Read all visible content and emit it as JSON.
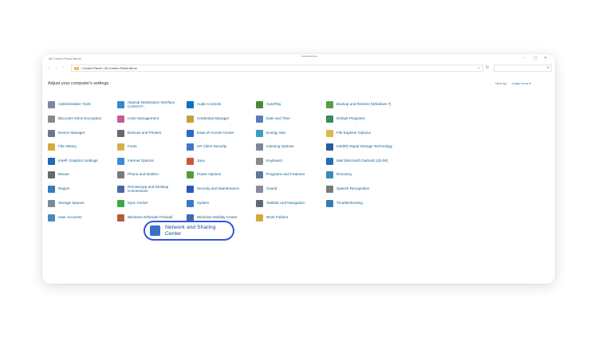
{
  "window": {
    "title": "All Control Panel Items",
    "controls": {
      "minimize": "−",
      "maximize": "▢",
      "close": "✕"
    }
  },
  "nav": {
    "back": "←",
    "forward": "→",
    "up": "↑"
  },
  "address": {
    "path": "› Control Panel › All Control Panel Items",
    "dropdown": "⌄",
    "refresh": "↻"
  },
  "search": {
    "placeholder": "",
    "icon": "⌕"
  },
  "heading": "Adjust your computer's settings",
  "view_by": {
    "label": "View by:",
    "value": "Large icons ▾"
  },
  "items": [
    {
      "label": "Administrative Tools",
      "icon": "tools-icon",
      "color": "#7a8aa0"
    },
    {
      "label": "Akamai NetSession Interface Control P...",
      "icon": "akamai-icon",
      "color": "#3a88c8"
    },
    {
      "label": "Audio Controls",
      "icon": "hp-icon",
      "color": "#0a6fbf"
    },
    {
      "label": "AutoPlay",
      "icon": "autoplay-icon",
      "color": "#4a8a3a"
    },
    {
      "label": "Backup and Restore (Windows 7)",
      "icon": "backup-icon",
      "color": "#5a9a48"
    },
    {
      "label": "BitLocker Drive Encryption",
      "icon": "bitlocker-icon",
      "color": "#8a8a8a"
    },
    {
      "label": "Color Management",
      "icon": "color-icon",
      "color": "#c85a9a"
    },
    {
      "label": "Credential Manager",
      "icon": "credential-icon",
      "color": "#c8a03a"
    },
    {
      "label": "Date and Time",
      "icon": "clock-icon",
      "color": "#5a7ab8"
    },
    {
      "label": "Default Programs",
      "icon": "default-programs-icon",
      "color": "#3a8a5a"
    },
    {
      "label": "Device Manager",
      "icon": "device-manager-icon",
      "color": "#6a7a8a"
    },
    {
      "label": "Devices and Printers",
      "icon": "printer-icon",
      "color": "#6a6a6a"
    },
    {
      "label": "Ease of Access Center",
      "icon": "ease-access-icon",
      "color": "#2a6ac8"
    },
    {
      "label": "Energy Star",
      "icon": "energy-icon",
      "color": "#3a9ac8"
    },
    {
      "label": "File Explorer Options",
      "icon": "folder-options-icon",
      "color": "#e0b84a"
    },
    {
      "label": "File History",
      "icon": "file-history-icon",
      "color": "#d8a83a"
    },
    {
      "label": "Fonts",
      "icon": "fonts-icon",
      "color": "#d8b04a"
    },
    {
      "label": "HP Client Security",
      "icon": "shield-icon",
      "color": "#3a7ac8"
    },
    {
      "label": "Indexing Options",
      "icon": "indexing-icon",
      "color": "#7a8a9a"
    },
    {
      "label": "Intel(R) Rapid Storage Technology",
      "icon": "intel-storage-icon",
      "color": "#2a5a9a"
    },
    {
      "label": "Intel® Graphics Settings",
      "icon": "intel-graphics-icon",
      "color": "#1a6ab8"
    },
    {
      "label": "Internet Options",
      "icon": "internet-icon",
      "color": "#3a8ad8"
    },
    {
      "label": "Java",
      "icon": "java-icon",
      "color": "#c85a3a"
    },
    {
      "label": "Keyboard",
      "icon": "keyboard-icon",
      "color": "#8a8a8a"
    },
    {
      "label": "Mail (Microsoft Outlook) (32-bit)",
      "icon": "mail-icon",
      "color": "#2a6ab8"
    },
    {
      "label": "Mouse",
      "icon": "mouse-icon",
      "color": "#6a6a6a"
    },
    {
      "label": "Phone and Modem",
      "icon": "phone-icon",
      "color": "#7a7a7a"
    },
    {
      "label": "Power Options",
      "icon": "power-icon",
      "color": "#5a9a3a"
    },
    {
      "label": "Programs and Features",
      "icon": "programs-icon",
      "color": "#5a7a9a"
    },
    {
      "label": "Recovery",
      "icon": "recovery-icon",
      "color": "#3a8ab8"
    },
    {
      "label": "Region",
      "icon": "region-icon",
      "color": "#3a7ab8"
    },
    {
      "label": "RemoteApp and Desktop Connections",
      "icon": "remote-icon",
      "color": "#4a6a9a"
    },
    {
      "label": "Security and Maintenance",
      "icon": "flag-icon",
      "color": "#2a5ab8"
    },
    {
      "label": "Sound",
      "icon": "sound-icon",
      "color": "#8a8a9a"
    },
    {
      "label": "Speech Recognition",
      "icon": "microphone-icon",
      "color": "#7a7a7a"
    },
    {
      "label": "Storage Spaces",
      "icon": "storage-icon",
      "color": "#7a8a9a"
    },
    {
      "label": "Sync Center",
      "icon": "sync-icon",
      "color": "#3aa84a"
    },
    {
      "label": "System",
      "icon": "system-icon",
      "color": "#3a7ac8"
    },
    {
      "label": "Taskbar and Navigation",
      "icon": "taskbar-icon",
      "color": "#5a6a7a"
    },
    {
      "label": "Troubleshooting",
      "icon": "troubleshoot-icon",
      "color": "#3a7ab8"
    },
    {
      "label": "User Accounts",
      "icon": "users-icon",
      "color": "#4a8ab8"
    },
    {
      "label": "Windows Defender Firewall",
      "icon": "firewall-icon",
      "color": "#b85a3a"
    },
    {
      "label": "Windows Mobility Center",
      "icon": "mobility-icon",
      "color": "#3a6ab8"
    },
    {
      "label": "Work Folders",
      "icon": "work-folders-icon",
      "color": "#d8a83a"
    }
  ],
  "highlight": {
    "label": "Network and Sharing Center",
    "icon": "network-icon",
    "color": "#3a70c8"
  }
}
